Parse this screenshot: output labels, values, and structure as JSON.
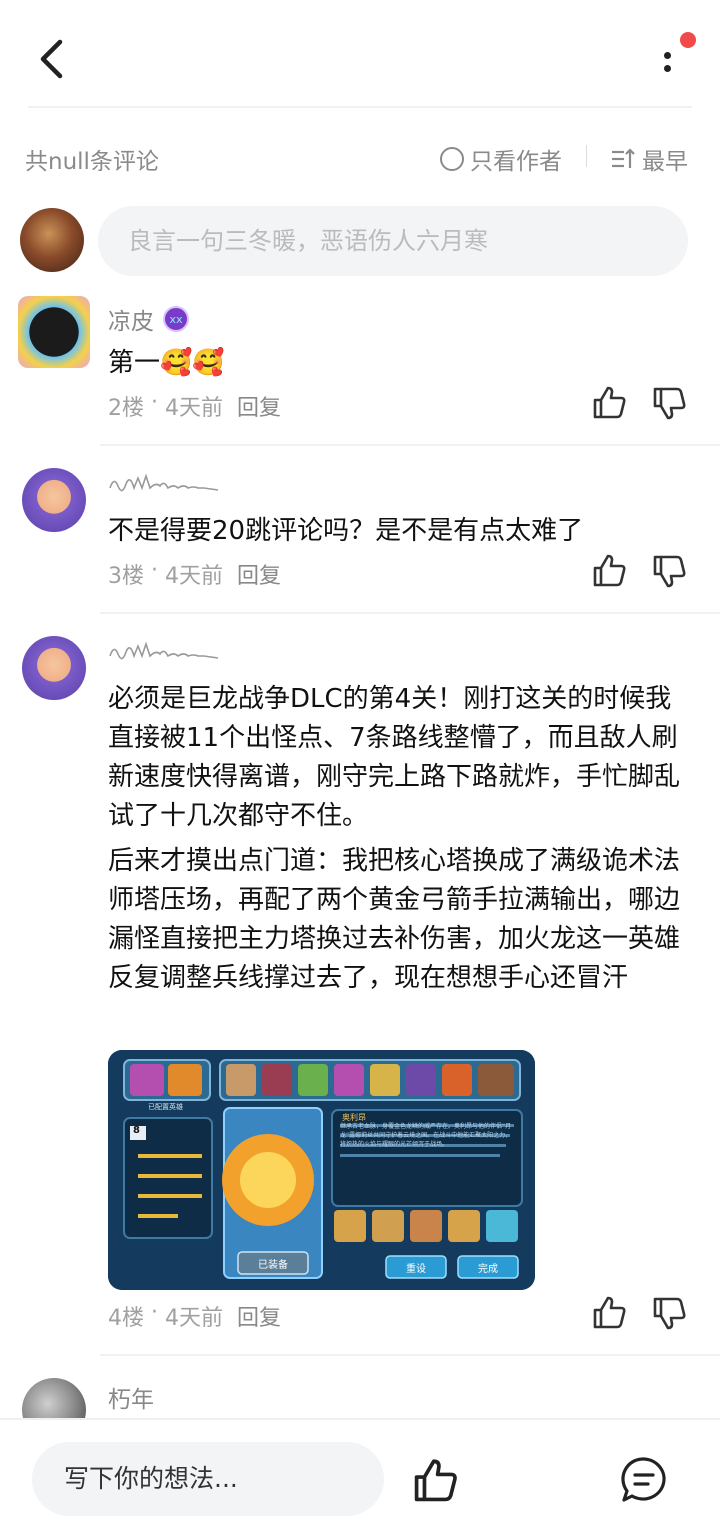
{
  "header": {
    "back_icon": "chevron-left-icon",
    "more_icon": "more-vertical-icon",
    "notification_color": "#f04a4a"
  },
  "filter": {
    "count_label": "共null条评论",
    "author_only_label": "只看作者",
    "sort_label": "最早"
  },
  "compose_top": {
    "placeholder": "良言一句三冬暖，恶语伤人六月寒"
  },
  "comments": [
    {
      "name": "凉皮",
      "text": "第一🥰🥰",
      "floor": "2楼",
      "time": "4天前",
      "reply": "回复"
    },
    {
      "name": "",
      "text": "不是得要20跳评论吗？是不是有点太难了",
      "floor": "3楼",
      "time": "4天前",
      "reply": "回复"
    },
    {
      "name": "",
      "text": "必须是巨龙战争DLC的第4关！刚打这关的时候我直接被11个出怪点、7条路线整懵了，而且敌人刷新速度快得离谱，刚守完上路下路就炸，手忙脚乱试了十几次都守不住。",
      "text2": "后来才摸出点门道：我把核心塔换成了满级诡术法师塔压场，再配了两个黄金弓箭手拉满输出，哪边漏怪直接把主力塔换过去补伤害，加火龙这一英雄反复调整兵线撑过去了，现在想想手心还冒汗",
      "floor": "4楼",
      "time": "4天前",
      "reply": "回复",
      "image": {
        "selected_label": "已配置英雄",
        "level": "8",
        "hero_name": "奥利昂",
        "description": "继承古老血脉，身覆金色龙鳞的威严存在。奥利昂与他的伴侣“月龙”露娜莉丝共同守护着云境之国。在战斗中他能汇聚太阳之力，将炽热的火焰与耀眼的光芒倾泻于战场。",
        "equipped_label": "已装备",
        "reset_label": "重设",
        "done_label": "完成"
      }
    },
    {
      "name": "朽年",
      "text": ""
    }
  ],
  "bottom": {
    "placeholder": "写下你的想法...",
    "like_icon": "thumbs-up-icon",
    "comment_icon": "comment-bubble-icon"
  }
}
